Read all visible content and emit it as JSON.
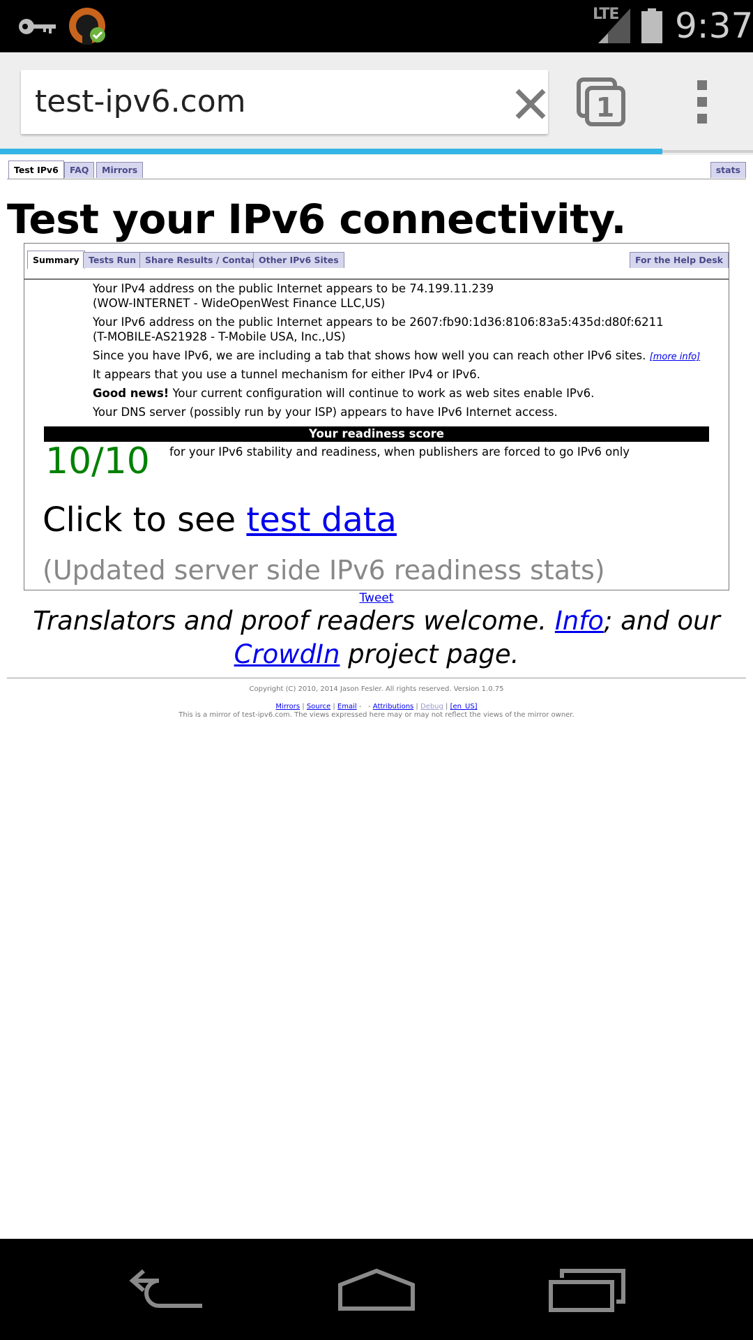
{
  "status_bar": {
    "icons": [
      "key-icon",
      "vpn-app-icon",
      "signal-icon",
      "battery-icon"
    ],
    "network": "LTE",
    "time": "9:37"
  },
  "browser": {
    "url": "test-ipv6.com",
    "tab_count": "1",
    "load_progress": 0.88,
    "accent_color": "#33b5e5"
  },
  "top_tabs": {
    "items": [
      {
        "label": "Test IPv6",
        "active": true
      },
      {
        "label": "FAQ",
        "active": false
      },
      {
        "label": "Mirrors",
        "active": false
      }
    ],
    "stats_label": "stats"
  },
  "headline": "Test your IPv6 connectivity.",
  "sub_tabs": {
    "items": [
      {
        "label": "Summary",
        "active": true
      },
      {
        "label": "Tests Run",
        "active": false
      },
      {
        "label": "Share Results / Contact",
        "active": false
      },
      {
        "label": "Other IPv6 Sites",
        "active": false
      }
    ],
    "help_desk_label": "For the Help Desk"
  },
  "summary": {
    "ipv4_line1": "Your IPv4 address on the public Internet appears to be 74.199.11.239",
    "ipv4_line2": "(WOW-INTERNET - WideOpenWest Finance LLC,US)",
    "ipv6_line1": "Your IPv6 address on the public Internet appears to be 2607:fb90:1d36:8106:83a5:435d:d80f:6211",
    "ipv6_line2": "(T-MOBILE-AS21928 - T-Mobile USA, Inc.,US)",
    "tab_note": "Since you have IPv6, we are including a tab that shows how well you can reach other IPv6 sites.",
    "more_info": "[more info]",
    "tunnel_note": "It appears that you use a tunnel mechanism for either IPv4 or IPv6.",
    "good_news_label": "Good news!",
    "good_news_text": " Your current configuration will continue to work as web sites enable IPv6.",
    "dns_note": "Your DNS server (possibly run by your ISP) appears to have IPv6 Internet access."
  },
  "readiness": {
    "header": "Your readiness score",
    "score": "10/10",
    "score_color": "#008000",
    "description": "for your IPv6 stability and readiness, when publishers are forced to go IPv6 only"
  },
  "test_data": {
    "prefix": "Click to see ",
    "link": "test data"
  },
  "stats_link": "(Updated server side IPv6 readiness stats)",
  "tweet": "Tweet",
  "translators": {
    "text1": "Translators and proof readers welcome. ",
    "info_link": "Info",
    "text2": "; and our",
    "crowdin_link": "CrowdIn",
    "text3": " project page."
  },
  "footer": {
    "copyright": "Copyright (C) 2010, 2014 Jason Fesler. All rights reserved. Version 1.0.75",
    "links": {
      "mirrors": "Mirrors",
      "source": "Source",
      "email": "Email",
      "attributions": "Attributions",
      "debug": "Debug",
      "locale": "[en_US]"
    },
    "mirror_note": "This is a mirror of test-ipv6.com. The views expressed here may or may not reflect the views of the mirror owner."
  },
  "nav_bar": {
    "icons": [
      "back-icon",
      "home-icon",
      "recents-icon"
    ]
  }
}
